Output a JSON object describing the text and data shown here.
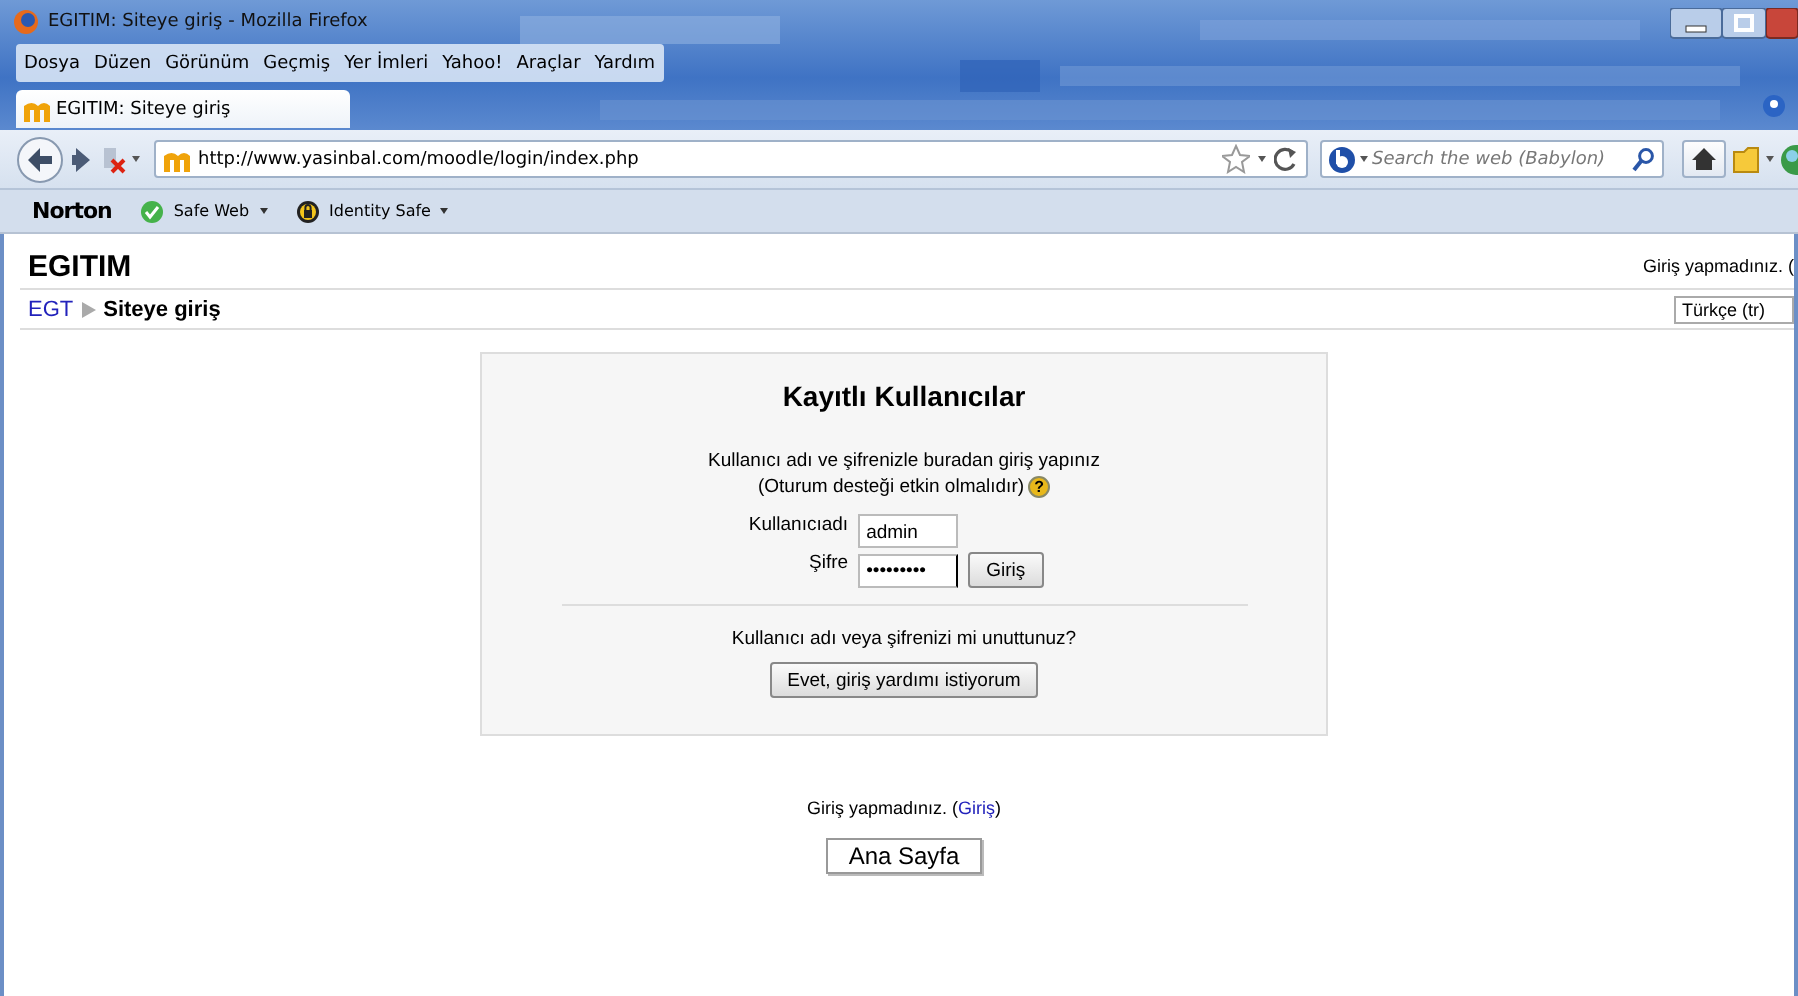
{
  "window": {
    "title": "EGITIM: Siteye giriş - Mozilla Firefox"
  },
  "menu": [
    "Dosya",
    "Düzen",
    "Görünüm",
    "Geçmiş",
    "Yer İmleri",
    "Yahoo!",
    "Araçlar",
    "Yardım"
  ],
  "tab": {
    "title": "EGITIM: Siteye giriş"
  },
  "address": "http://www.yasinbal.com/moodle/login/index.php",
  "search": {
    "placeholder": "Search the web (Babylon)"
  },
  "norton_bar": {
    "brand": "Norton",
    "items": [
      "Safe Web",
      "Identity Safe"
    ]
  },
  "page": {
    "site_title": "EGITIM",
    "login_status": "Giriş yapmadınız. (",
    "breadcrumb": [
      "EGT",
      "Siteye giriş"
    ],
    "language": "Türkçe (tr)"
  },
  "login": {
    "title": "Kayıtlı Kullanıcılar",
    "intro": "Kullanıcı adı ve şifrenizle buradan giriş yapınız",
    "note": "(Oturum desteği etkin olmalıdır)",
    "help": "?",
    "fields": [
      {
        "label": "Kullanıcıadı",
        "value": "admin"
      },
      {
        "label": "Şifre",
        "value": "•••••••••"
      }
    ],
    "submit": "Giriş",
    "forgot": "Kullanıcı adı veya şifrenizi mi unuttunuz?",
    "forgot_button": "Evet, giriş yardımı istiyorum"
  },
  "footer": {
    "before": "Giriş yapmadınız. (",
    "link": "Giriş",
    "after": ")",
    "button": "Ana Sayfa"
  }
}
